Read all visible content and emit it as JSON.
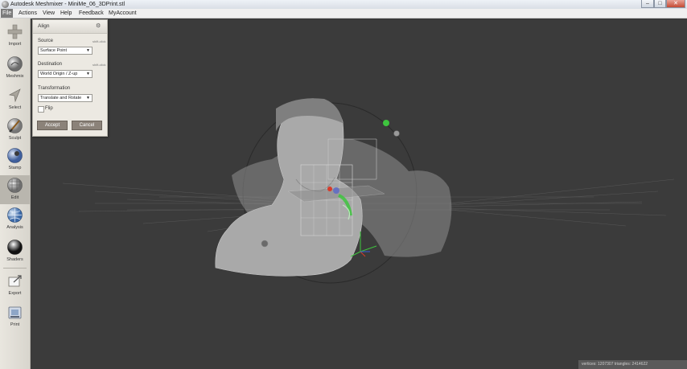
{
  "window": {
    "title": "Autodesk Meshmixer - MiniMe_06_3DPrint.stl",
    "controls": {
      "minimize": "–",
      "maximize": "□",
      "close": "✕"
    }
  },
  "menu": {
    "items": [
      {
        "label": "File",
        "active": true
      },
      {
        "label": "Actions",
        "active": false
      },
      {
        "label": "View",
        "active": false
      },
      {
        "label": "Help",
        "active": false
      },
      {
        "label": "Feedback",
        "active": false
      },
      {
        "label": "MyAccount",
        "active": false
      }
    ]
  },
  "toolbar": {
    "tools": [
      {
        "label": "Import",
        "icon": "import-plus-icon"
      },
      {
        "label": "Meshmix",
        "icon": "meshmix-sphere-icon"
      },
      {
        "label": "Select",
        "icon": "select-arrow-icon"
      },
      {
        "label": "Sculpt",
        "icon": "sculpt-brush-icon"
      },
      {
        "label": "Stamp",
        "icon": "stamp-icon"
      },
      {
        "label": "Edit",
        "icon": "edit-icon",
        "selected": true
      },
      {
        "label": "Analysis",
        "icon": "analysis-globe-icon"
      },
      {
        "label": "Shaders",
        "icon": "shaders-sphere-icon"
      },
      {
        "label": "Export",
        "icon": "export-icon"
      },
      {
        "label": "Print",
        "icon": "print-icon"
      }
    ]
  },
  "align_panel": {
    "title": "Align",
    "source": {
      "label": "Source",
      "link": "shift-click",
      "value": "Surface Point"
    },
    "destination": {
      "label": "Destination",
      "link": "shift-click",
      "value": "World Origin / Z-up"
    },
    "transformation": {
      "label": "Transformation",
      "value": "Translate and Rotate"
    },
    "flip": {
      "label": "Flip",
      "checked": false
    },
    "accept_label": "Accept",
    "cancel_label": "Cancel"
  },
  "status": {
    "text": "vertices: 1207307  triangles: 2414622"
  },
  "colors": {
    "viewport_bg": "#3b3b3b",
    "toolbar_bg": "#e2dfd8",
    "button_bg": "#8b8279",
    "gizmo_green": "#3ec43e",
    "gizmo_red": "#d83a2a",
    "gizmo_blue": "#3a5ad8"
  }
}
